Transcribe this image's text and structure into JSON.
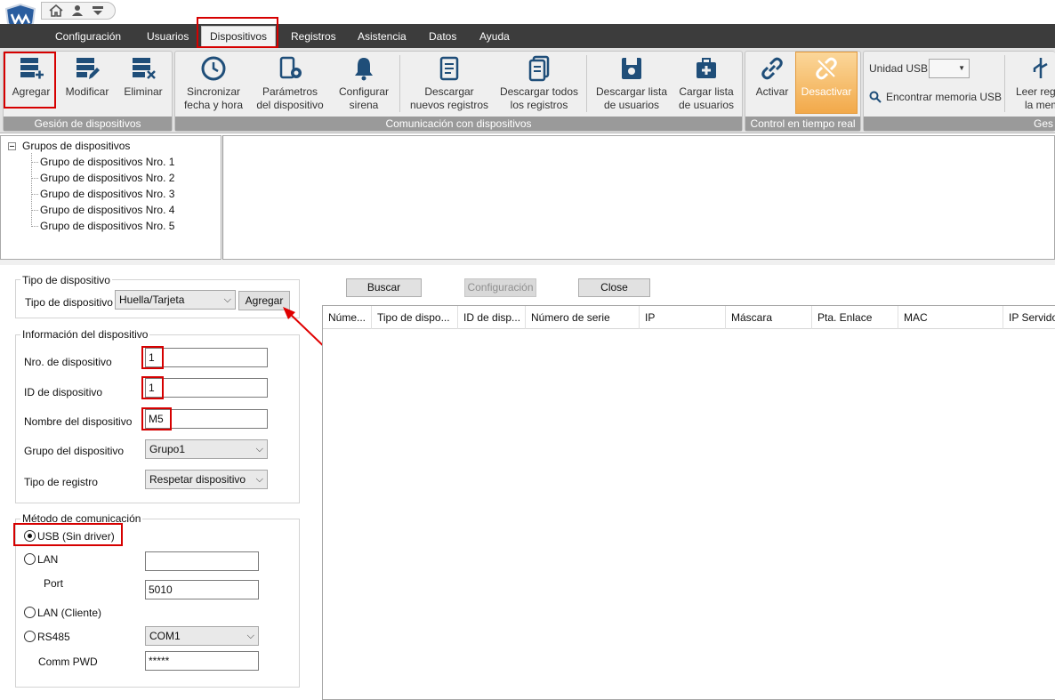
{
  "menu": {
    "tabs": [
      "Configuración",
      "Usuarios",
      "Dispositivos",
      "Registros",
      "Asistencia",
      "Datos",
      "Ayuda"
    ],
    "active": "Dispositivos"
  },
  "ribbon": {
    "device_mgmt": {
      "label": "Gesión de dispositivos",
      "add": "Agregar",
      "modify": "Modificar",
      "delete": "Eliminar"
    },
    "comm": {
      "label": "Comunicación con dispositivos",
      "sync_time": [
        "Sincronizar",
        "fecha y hora"
      ],
      "device_params": [
        "Parámetros",
        "del dispositivo"
      ],
      "siren": [
        "Configurar",
        "sirena"
      ],
      "download_new": [
        "Descargar",
        "nuevos registros"
      ],
      "download_all": [
        "Descargar todos",
        "los registros"
      ],
      "download_users": [
        "Descargar lista",
        "de usuarios"
      ],
      "upload_users": [
        "Cargar lista",
        "de usuarios"
      ]
    },
    "realtime": {
      "label": "Control en tiempo real",
      "activate": "Activar",
      "deactivate": "Desactivar"
    },
    "usb": {
      "unit_label": "Unidad USB",
      "find_usb": "Encontrar memoria USB",
      "read": [
        "Leer regi",
        "la mem"
      ],
      "group_label": "Ges"
    }
  },
  "tree": {
    "root": "Grupos de dispositivos",
    "items": [
      "Grupo de dispositivos Nro. 1",
      "Grupo de dispositivos Nro. 2",
      "Grupo de dispositivos Nro. 3",
      "Grupo de dispositivos Nro. 4",
      "Grupo de dispositivos Nro. 5"
    ]
  },
  "form": {
    "device_type_section": "Tipo de dispositivo",
    "device_type_label": "Tipo de dispositivo",
    "device_type_value": "Huella/Tarjeta",
    "add_button": "Agregar",
    "info_section": "Información del dispositivo",
    "device_number_label": "Nro. de dispositivo",
    "device_number_value": "1",
    "device_id_label": "ID de dispositivo",
    "device_id_value": "1",
    "device_name_label": "Nombre del dispositivo",
    "device_name_value": "M5",
    "device_group_label": "Grupo del dispositivo",
    "device_group_value": "Grupo1",
    "record_type_label": "Tipo de registro",
    "record_type_value": "Respetar dispositivo",
    "comm_section": "Método de comunicación",
    "usb_option": "USB (Sin driver)",
    "lan_option": "LAN",
    "lan_ip_value": "",
    "port_label": "Port",
    "port_value": "5010",
    "lan_client_option": "LAN (Cliente)",
    "rs485_option": "RS485",
    "com_value": "COM1",
    "comm_pwd_label": "Comm PWD",
    "comm_pwd_value": "*****"
  },
  "search_panel": {
    "search_button": "Buscar",
    "config_button": "Configuración",
    "close_button": "Close",
    "columns": [
      "Núme...",
      "Tipo de dispo...",
      "ID de disp...",
      "Número de serie",
      "IP",
      "Máscara",
      "Pta. Enlace",
      "MAC",
      "IP Servidor"
    ]
  },
  "colors": {
    "highlight": "#d60000",
    "menubar": "#3c3c3c",
    "group_label_bg": "#9a9a9a",
    "deactivate_bg": "#f2a94a"
  }
}
